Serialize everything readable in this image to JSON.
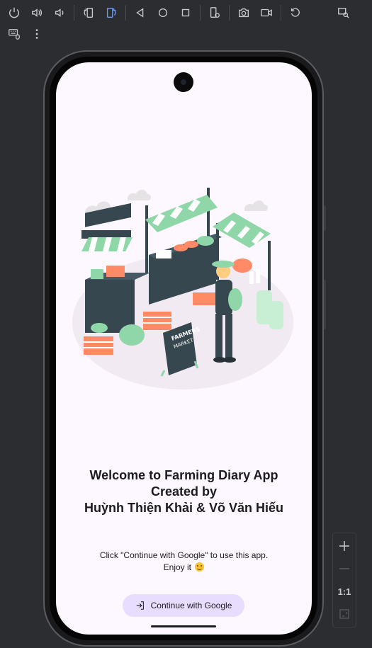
{
  "toolbar": {
    "row1": [
      "power-icon",
      "volume-up-icon",
      "volume-down-icon",
      "rotate-left-icon",
      "rotate-right-icon",
      "back-icon",
      "home-icon",
      "overview-icon",
      "device-settings-icon",
      "camera-icon",
      "video-icon",
      "reset-icon",
      "zoom-search-icon"
    ],
    "row2": [
      "keyboard-mouse-icon",
      "more-vert-icon"
    ]
  },
  "app": {
    "welcome_line1": "Welcome to Farming Diary App",
    "welcome_line2": "Created by",
    "welcome_line3": "Huỳnh Thiện Khải & Võ Văn Hiếu",
    "hint_line1": "Click \"Continue with Google\" to use this app.",
    "hint_line2": "Enjoy it",
    "continue_button": "Continue with Google"
  },
  "illustration_text": {
    "sign_line1": "FARMERS",
    "sign_line2": "MARKET"
  },
  "zoom_controls": {
    "ratio_label": "1:1"
  },
  "colors": {
    "screen_bg": "#fdf7ff",
    "button_bg": "#e9ddff",
    "accent_green": "#8fd6a8",
    "dark_stall": "#37474f"
  }
}
